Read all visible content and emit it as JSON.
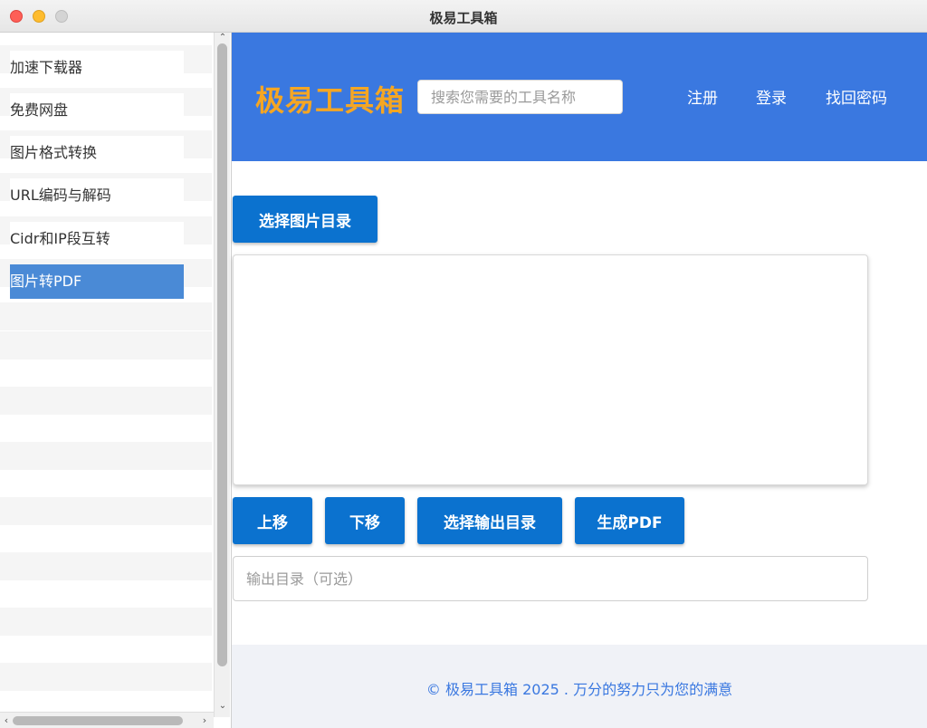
{
  "window": {
    "title": "极易工具箱"
  },
  "sidebar": {
    "items": [
      {
        "label": "加速下载器"
      },
      {
        "label": "免费网盘"
      },
      {
        "label": "图片格式转换"
      },
      {
        "label": "URL编码与解码"
      },
      {
        "label": "Cidr和IP段互转"
      },
      {
        "label": "图片转PDF",
        "active": true
      }
    ]
  },
  "header": {
    "brand": "极易工具箱",
    "search_placeholder": "搜索您需要的工具名称",
    "links": {
      "register": "注册",
      "login": "登录",
      "recover": "找回密码"
    },
    "brand_color": "#f5a623",
    "bg_color": "#3a78e0"
  },
  "main": {
    "select_dir_button": "选择图片目录",
    "move_up_button": "上移",
    "move_down_button": "下移",
    "select_output_button": "选择输出目录",
    "generate_button": "生成PDF",
    "output_placeholder": "输出目录（可选）",
    "button_color": "#0b72cf"
  },
  "footer": {
    "text": "© 极易工具箱 2025 . 万分的努力只为您的满意"
  }
}
